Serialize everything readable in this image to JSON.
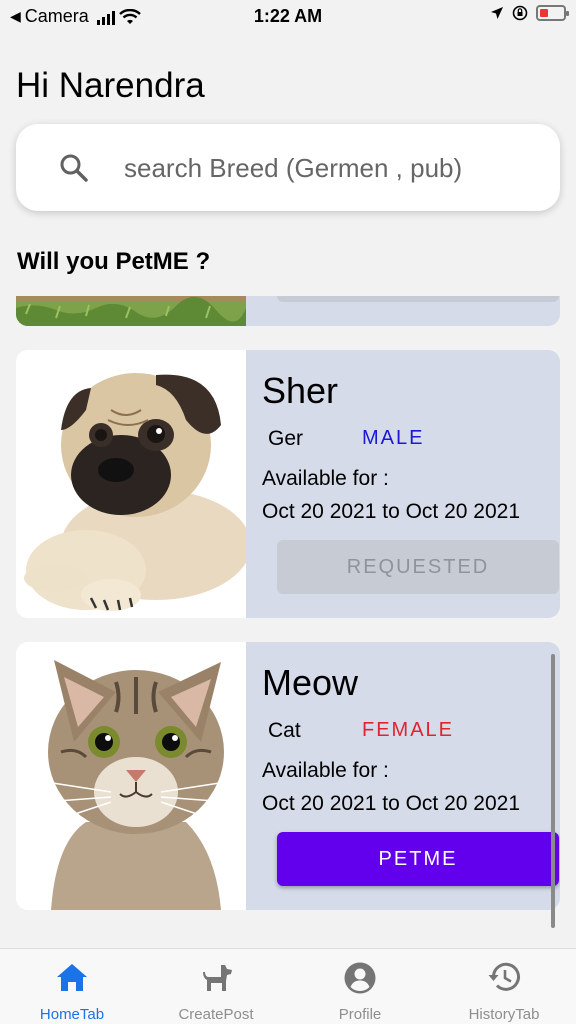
{
  "status_bar": {
    "back_app": "Camera",
    "time": "1:22 AM"
  },
  "greeting": "Hi Narendra",
  "search": {
    "placeholder": "search Breed (Germen , pub)",
    "value": ""
  },
  "section_title": "Will you PetME ?",
  "pets": [
    {
      "name": "Sher",
      "breed": "Ger",
      "gender": "MALE",
      "gender_color": "#1a1ad6",
      "available_label": "Available for :",
      "available_dates": "Oct 20 2021 to Oct 20 2021",
      "action_label": "REQUESTED",
      "image": "pug-dog"
    },
    {
      "name": "Meow",
      "breed": "Cat",
      "gender": "FEMALE",
      "gender_color": "#e0242b",
      "available_label": "Available for :",
      "available_dates": "Oct 20 2021 to Oct 20 2021",
      "action_label": "PETME",
      "image": "tabby-cat"
    }
  ],
  "tabs": [
    {
      "label": "HomeTab",
      "icon": "home-icon",
      "active": true
    },
    {
      "label": "CreatePost",
      "icon": "dog-icon",
      "active": false
    },
    {
      "label": "Profile",
      "icon": "account-circle-icon",
      "active": false
    },
    {
      "label": "HistoryTab",
      "icon": "history-icon",
      "active": false
    }
  ],
  "colors": {
    "accent": "#6200ee",
    "active_tab": "#1a73e8",
    "card_bg": "#d6dbe9"
  }
}
